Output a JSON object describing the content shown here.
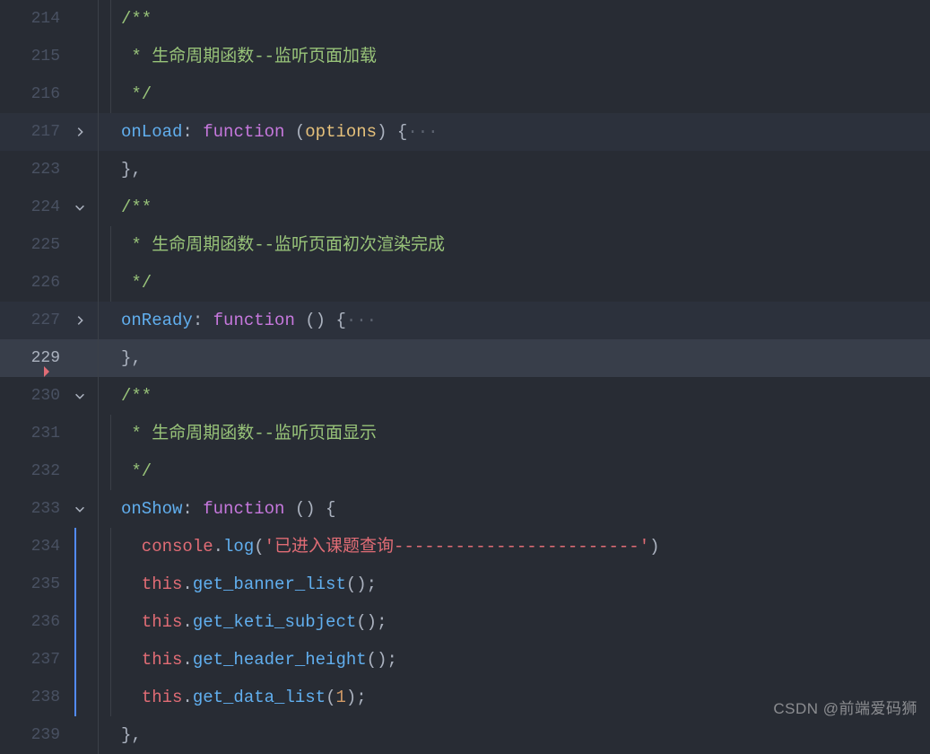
{
  "watermark": "CSDN @前端爱码狮",
  "lines": [
    {
      "num": "214",
      "fold": null,
      "guides": [
        true,
        true
      ],
      "hl": false,
      "active": false,
      "tokens": [
        {
          "c": "",
          "t": ""
        },
        {
          "c": "/**",
          "t": "tok-doc"
        }
      ]
    },
    {
      "num": "215",
      "fold": null,
      "guides": [
        true,
        true
      ],
      "hl": false,
      "active": false,
      "tokens": [
        {
          "c": " * 生命周期函数--监听页面加载",
          "t": "tok-doc"
        }
      ]
    },
    {
      "num": "216",
      "fold": null,
      "guides": [
        true,
        true
      ],
      "hl": false,
      "active": false,
      "tokens": [
        {
          "c": " */",
          "t": "tok-doc"
        }
      ]
    },
    {
      "num": "217",
      "fold": "right",
      "guides": [
        true,
        false
      ],
      "hl": true,
      "active": false,
      "tokens": [
        {
          "c": "onLoad",
          "t": "tok-fn"
        },
        {
          "c": ": ",
          "t": "tok-punct"
        },
        {
          "c": "function",
          "t": "tok-kw"
        },
        {
          "c": " (",
          "t": "tok-punct"
        },
        {
          "c": "options",
          "t": "tok-key"
        },
        {
          "c": ") {",
          "t": "tok-punct"
        },
        {
          "c": "···",
          "t": "tok-dim"
        }
      ]
    },
    {
      "num": "223",
      "fold": null,
      "guides": [
        true,
        false
      ],
      "hl": false,
      "active": false,
      "tokens": [
        {
          "c": "},",
          "t": "tok-punct"
        }
      ]
    },
    {
      "num": "224",
      "fold": "down",
      "guides": [
        true,
        false
      ],
      "hl": false,
      "active": false,
      "tokens": [
        {
          "c": "/**",
          "t": "tok-doc"
        }
      ]
    },
    {
      "num": "225",
      "fold": null,
      "guides": [
        true,
        true
      ],
      "hl": false,
      "active": false,
      "tokens": [
        {
          "c": " * 生命周期函数--监听页面初次渲染完成",
          "t": "tok-doc"
        }
      ]
    },
    {
      "num": "226",
      "fold": null,
      "guides": [
        true,
        true
      ],
      "hl": false,
      "active": false,
      "tokens": [
        {
          "c": " */",
          "t": "tok-doc"
        }
      ]
    },
    {
      "num": "227",
      "fold": "right",
      "guides": [
        true,
        false
      ],
      "hl": true,
      "active": false,
      "tokens": [
        {
          "c": "onReady",
          "t": "tok-fn"
        },
        {
          "c": ": ",
          "t": "tok-punct"
        },
        {
          "c": "function",
          "t": "tok-kw"
        },
        {
          "c": " () {",
          "t": "tok-punct"
        },
        {
          "c": "···",
          "t": "tok-dim"
        }
      ]
    },
    {
      "num": "229",
      "fold": null,
      "guides": [
        true,
        false
      ],
      "hl": false,
      "active": true,
      "tokens": [
        {
          "c": "},",
          "t": "tok-punct"
        }
      ],
      "bookmark": true
    },
    {
      "num": "230",
      "fold": "down",
      "guides": [
        true,
        false
      ],
      "hl": false,
      "active": false,
      "tokens": [
        {
          "c": "/**",
          "t": "tok-doc"
        }
      ]
    },
    {
      "num": "231",
      "fold": null,
      "guides": [
        true,
        true
      ],
      "hl": false,
      "active": false,
      "tokens": [
        {
          "c": " * 生命周期函数--监听页面显示",
          "t": "tok-doc"
        }
      ]
    },
    {
      "num": "232",
      "fold": null,
      "guides": [
        true,
        true
      ],
      "hl": false,
      "active": false,
      "tokens": [
        {
          "c": " */",
          "t": "tok-doc"
        }
      ]
    },
    {
      "num": "233",
      "fold": "down",
      "guides": [
        true,
        false
      ],
      "hl": false,
      "active": false,
      "tokens": [
        {
          "c": "onShow",
          "t": "tok-fn"
        },
        {
          "c": ": ",
          "t": "tok-punct"
        },
        {
          "c": "function",
          "t": "tok-kw"
        },
        {
          "c": " () {",
          "t": "tok-punct"
        }
      ]
    },
    {
      "num": "234",
      "fold": null,
      "guides": [
        true,
        true,
        "a"
      ],
      "hl": false,
      "active": false,
      "tokens": [
        {
          "c": "  console",
          "t": "tok-param"
        },
        {
          "c": ".",
          "t": "tok-punct"
        },
        {
          "c": "log",
          "t": "tok-fn"
        },
        {
          "c": "(",
          "t": "tok-punct"
        },
        {
          "c": "'已进入课题查询------------------------'",
          "t": "tok-str"
        },
        {
          "c": ")",
          "t": "tok-punct"
        }
      ]
    },
    {
      "num": "235",
      "fold": null,
      "guides": [
        true,
        true,
        "a"
      ],
      "hl": false,
      "active": false,
      "tokens": [
        {
          "c": "  ",
          "t": ""
        },
        {
          "c": "this",
          "t": "tok-this"
        },
        {
          "c": ".",
          "t": "tok-punct"
        },
        {
          "c": "get_banner_list",
          "t": "tok-fn"
        },
        {
          "c": "();",
          "t": "tok-punct"
        }
      ]
    },
    {
      "num": "236",
      "fold": null,
      "guides": [
        true,
        true,
        "a"
      ],
      "hl": false,
      "active": false,
      "tokens": [
        {
          "c": "  ",
          "t": ""
        },
        {
          "c": "this",
          "t": "tok-this"
        },
        {
          "c": ".",
          "t": "tok-punct"
        },
        {
          "c": "get_keti_subject",
          "t": "tok-fn"
        },
        {
          "c": "();",
          "t": "tok-punct"
        }
      ]
    },
    {
      "num": "237",
      "fold": null,
      "guides": [
        true,
        true,
        "a"
      ],
      "hl": false,
      "active": false,
      "tokens": [
        {
          "c": "  ",
          "t": ""
        },
        {
          "c": "this",
          "t": "tok-this"
        },
        {
          "c": ".",
          "t": "tok-punct"
        },
        {
          "c": "get_header_height",
          "t": "tok-fn"
        },
        {
          "c": "();",
          "t": "tok-punct"
        }
      ]
    },
    {
      "num": "238",
      "fold": null,
      "guides": [
        true,
        true,
        "a"
      ],
      "hl": false,
      "active": false,
      "tokens": [
        {
          "c": "  ",
          "t": ""
        },
        {
          "c": "this",
          "t": "tok-this"
        },
        {
          "c": ".",
          "t": "tok-punct"
        },
        {
          "c": "get_data_list",
          "t": "tok-fn"
        },
        {
          "c": "(",
          "t": "tok-punct"
        },
        {
          "c": "1",
          "t": "tok-num"
        },
        {
          "c": ");",
          "t": "tok-punct"
        }
      ]
    },
    {
      "num": "239",
      "fold": null,
      "guides": [
        true,
        false
      ],
      "hl": false,
      "active": false,
      "tokens": [
        {
          "c": "},",
          "t": "tok-punct"
        }
      ]
    }
  ]
}
